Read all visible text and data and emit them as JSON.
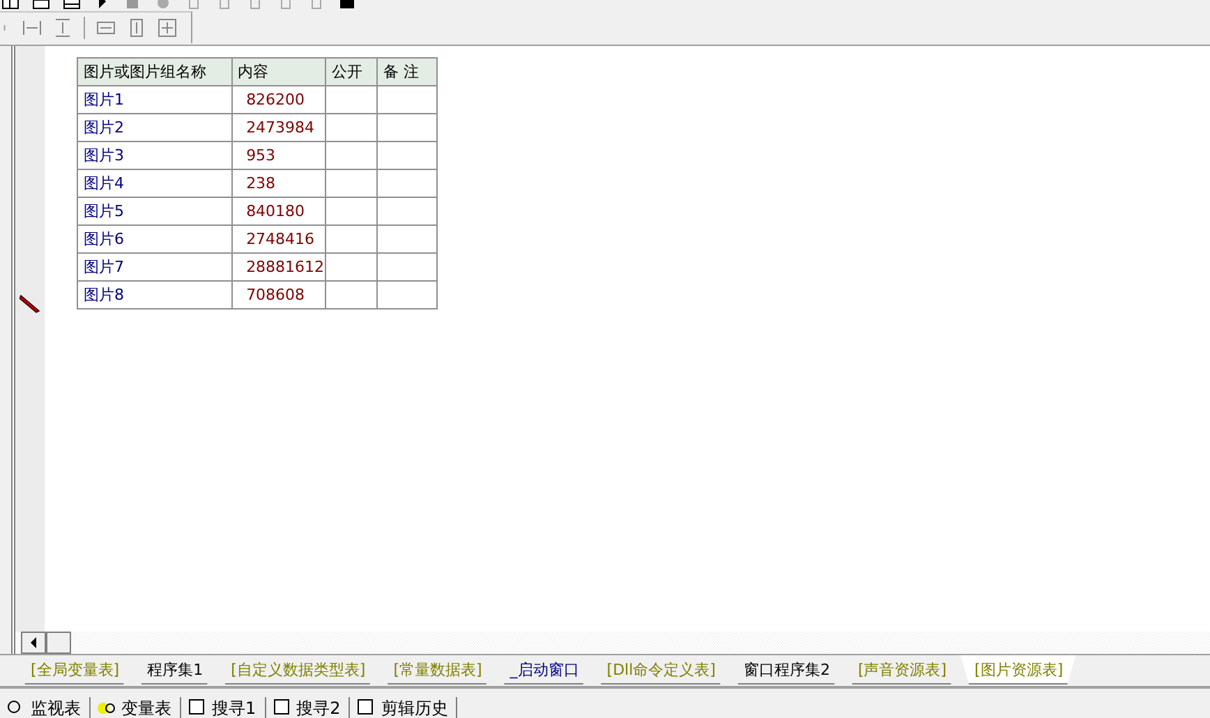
{
  "table": {
    "columns": [
      "图片或图片组名称",
      "内容",
      "公开",
      "备 注"
    ],
    "rows": [
      {
        "name": "图片1",
        "content": "826200"
      },
      {
        "name": "图片2",
        "content": "2473984"
      },
      {
        "name": "图片3",
        "content": "953"
      },
      {
        "name": "图片4",
        "content": "238"
      },
      {
        "name": "图片5",
        "content": "840180"
      },
      {
        "name": "图片6",
        "content": "2748416"
      },
      {
        "name": "图片7",
        "content": "28881612"
      },
      {
        "name": "图片8",
        "content": "708608"
      }
    ]
  },
  "tabs": [
    {
      "label": "[全局变量表]",
      "kind": "table",
      "selected": false
    },
    {
      "label": "程序集1",
      "kind": "code",
      "selected": false
    },
    {
      "label": "[自定义数据类型表]",
      "kind": "table",
      "selected": false
    },
    {
      "label": "[常量数据表]",
      "kind": "table",
      "selected": false
    },
    {
      "label": "_启动窗口",
      "kind": "window",
      "selected": false
    },
    {
      "label": "[Dll命令定义表]",
      "kind": "table",
      "selected": false
    },
    {
      "label": "窗口程序集2",
      "kind": "code",
      "selected": false
    },
    {
      "label": "[声音资源表]",
      "kind": "table",
      "selected": false
    },
    {
      "label": "[图片资源表]",
      "kind": "table",
      "selected": true
    }
  ],
  "panel_tabs": [
    "监视表",
    "变量表",
    "搜寻1",
    "搜寻2",
    "剪辑历史"
  ]
}
